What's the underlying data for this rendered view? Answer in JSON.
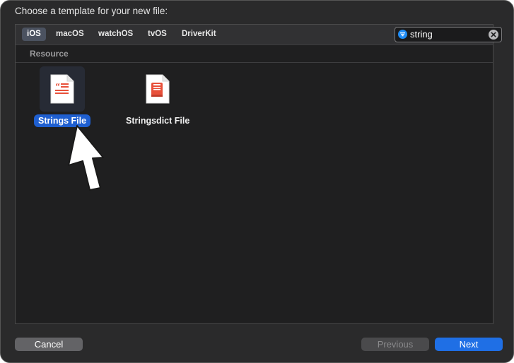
{
  "dialog": {
    "title": "Choose a template for your new file:"
  },
  "platform_tabs": [
    {
      "label": "iOS",
      "selected": true
    },
    {
      "label": "macOS",
      "selected": false
    },
    {
      "label": "watchOS",
      "selected": false
    },
    {
      "label": "tvOS",
      "selected": false
    },
    {
      "label": "DriverKit",
      "selected": false
    }
  ],
  "search": {
    "value": "string",
    "filter_icon": "filter-icon",
    "clear_icon": "clear-icon"
  },
  "section": {
    "header": "Resource"
  },
  "templates": [
    {
      "label": "Strings File",
      "icon": "strings-file-icon",
      "selected": true
    },
    {
      "label": "Stringsdict File",
      "icon": "stringsdict-file-icon",
      "selected": false
    }
  ],
  "buttons": {
    "cancel": "Cancel",
    "previous": "Previous",
    "next": "Next"
  },
  "colors": {
    "accent": "#1f6fe5",
    "selection": "#1f5fd0",
    "file_icon_accent": "#e8503a"
  }
}
